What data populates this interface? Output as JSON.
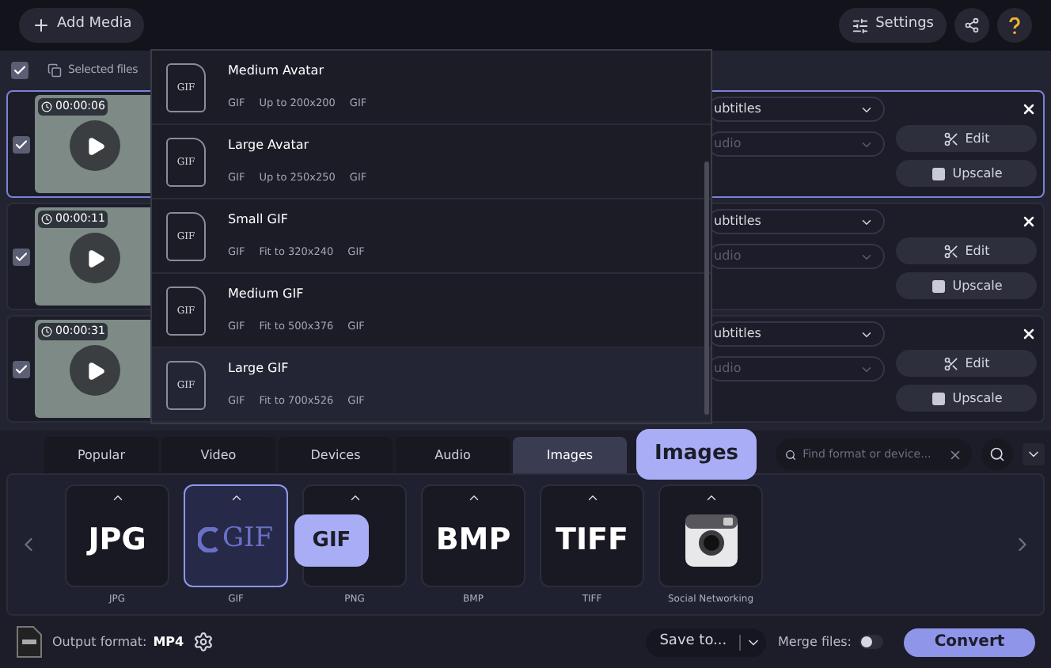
{
  "toolbar": {
    "add_media": "Add Media",
    "settings": "Settings"
  },
  "list_header": {
    "checked": true,
    "label": "Selected files"
  },
  "files": [
    {
      "checked": true,
      "selected": true,
      "duration": "00:00:06",
      "subtitles": "ubtitles",
      "audio": "udio",
      "edit": "Edit",
      "upscale": "Upscale"
    },
    {
      "checked": true,
      "selected": false,
      "duration": "00:00:11",
      "subtitles": "ubtitles",
      "audio": "udio",
      "edit": "Edit",
      "upscale": "Upscale"
    },
    {
      "checked": true,
      "selected": false,
      "duration": "00:00:31",
      "subtitles": "ubtitles",
      "audio": "udio",
      "edit": "Edit",
      "upscale": "Upscale"
    }
  ],
  "preset_menu": [
    {
      "icon_text": "GIF",
      "name": "Medium Avatar",
      "format": "GIF",
      "size": "Up to 200x200",
      "codec": "GIF",
      "selected": false
    },
    {
      "icon_text": "GIF",
      "name": "Large Avatar",
      "format": "GIF",
      "size": "Up to 250x250",
      "codec": "GIF",
      "selected": false
    },
    {
      "icon_text": "GIF",
      "name": "Small GIF",
      "format": "GIF",
      "size": "Fit to 320x240",
      "codec": "GIF",
      "selected": false
    },
    {
      "icon_text": "GIF",
      "name": "Medium GIF",
      "format": "GIF",
      "size": "Fit to 500x376",
      "codec": "GIF",
      "selected": false
    },
    {
      "icon_text": "GIF",
      "name": "Large GIF",
      "format": "GIF",
      "size": "Fit to 700x526",
      "codec": "GIF",
      "selected": true
    }
  ],
  "tabs": [
    {
      "label": "Popular",
      "selected": false
    },
    {
      "label": "Video",
      "selected": false
    },
    {
      "label": "Devices",
      "selected": false
    },
    {
      "label": "Audio",
      "selected": false
    },
    {
      "label": "Images",
      "selected": true
    }
  ],
  "search": {
    "placeholder": "Find format or device..."
  },
  "formats": [
    {
      "kind": "text",
      "logo": "JPG",
      "label": "JPG",
      "selected": false
    },
    {
      "kind": "gif",
      "logo": "GIF",
      "label": "GIF",
      "selected": true
    },
    {
      "kind": "blank",
      "label": "PNG",
      "selected": false
    },
    {
      "kind": "text",
      "logo": "BMP",
      "label": "BMP",
      "selected": false
    },
    {
      "kind": "text",
      "logo": "TIFF",
      "label": "TIFF",
      "selected": false
    },
    {
      "kind": "camera",
      "label": "Social Networking",
      "selected": false
    }
  ],
  "callouts": [
    {
      "text": "Images"
    },
    {
      "text": "GIF"
    }
  ],
  "bottom_bar": {
    "output_label": "Output format:",
    "output_value": "MP4",
    "save_to": "Save to...",
    "merge_label": "Merge files:",
    "merge_on": false,
    "convert": "Convert"
  }
}
